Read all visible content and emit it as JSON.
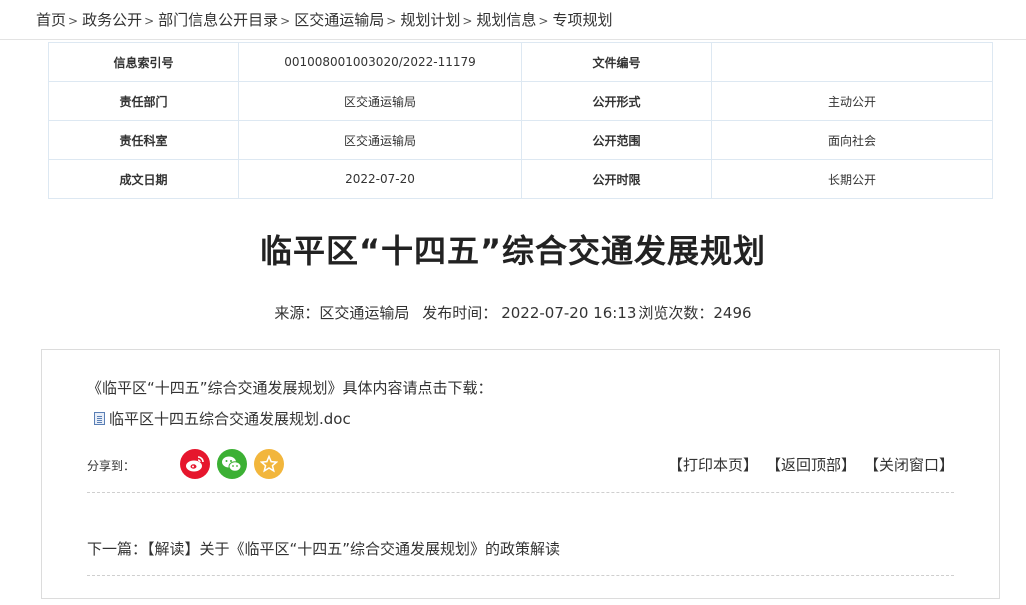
{
  "breadcrumb": {
    "items": [
      "首页",
      "政务公开",
      "部门信息公开目录",
      "区交通运输局",
      "规划计划",
      "规划信息",
      "专项规划"
    ],
    "separator": ">"
  },
  "meta_table": {
    "rows": [
      {
        "k1": "信息索引号",
        "v1": "001008001003020/2022-11179",
        "k2": "文件编号",
        "v2": ""
      },
      {
        "k1": "责任部门",
        "v1": "区交通运输局",
        "k2": "公开形式",
        "v2": "主动公开"
      },
      {
        "k1": "责任科室",
        "v1": "区交通运输局",
        "k2": "公开范围",
        "v2": "面向社会"
      },
      {
        "k1": "成文日期",
        "v1": "2022-07-20",
        "k2": "公开时限",
        "v2": "长期公开"
      }
    ]
  },
  "article": {
    "title": "临平区“十四五”综合交通发展规划",
    "source_label": "来源：区交通运输局",
    "publish_label": "发布时间：",
    "publish_time": "2022-07-20 16:13",
    "views_label": "浏览次数：2496",
    "intro": "《临平区“十四五”综合交通发展规划》具体内容请点击下载：",
    "attachment": "临平区十四五综合交通发展规划.doc"
  },
  "share": {
    "label": "分享到：",
    "icons": [
      "weibo-icon",
      "wechat-icon",
      "favorite-icon"
    ]
  },
  "actions": {
    "print": "【打印本页】",
    "top": "【返回顶部】",
    "close": "【关闭窗口】"
  },
  "next": {
    "label": "下一篇：",
    "title": "【解读】关于《临平区“十四五”综合交通发展规划》的政策解读"
  },
  "colors": {
    "table_border": "#dde8f2",
    "weibo": "#e6162d",
    "wechat": "#3cb034",
    "favorite": "#f2b63c"
  }
}
